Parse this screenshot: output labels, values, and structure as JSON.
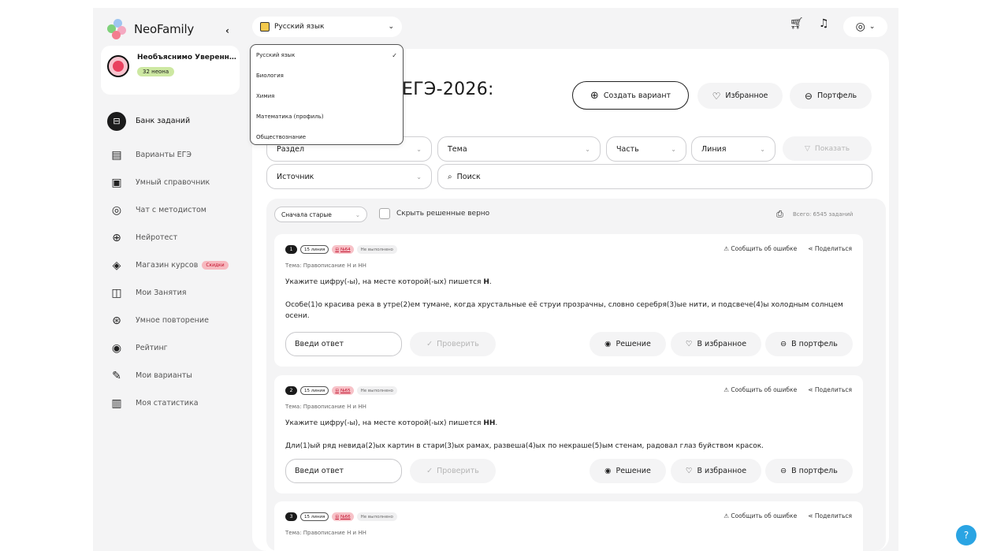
{
  "app": {
    "name": "NeoFamily"
  },
  "user": {
    "name": "Необъяснимо Уверенн…",
    "balance": "32 неона"
  },
  "nav": [
    {
      "label": "Банк заданий",
      "icon": "archive-icon",
      "glyph": "⊟"
    },
    {
      "label": "Варианты ЕГЭ",
      "icon": "document-icon",
      "glyph": "▤"
    },
    {
      "label": "Умный справочник",
      "icon": "book-icon",
      "glyph": "▣"
    },
    {
      "label": "Чат с методистом",
      "icon": "chat-icon",
      "glyph": "◎"
    },
    {
      "label": "Нейротест",
      "icon": "robot-icon",
      "glyph": "⊕"
    },
    {
      "label": "Магазин курсов",
      "icon": "graduation-cap-icon",
      "glyph": "◈",
      "badge": "Скидки"
    },
    {
      "label": "Мои Занятия",
      "icon": "open-book-icon",
      "glyph": "◫"
    },
    {
      "label": "Умное повторение",
      "icon": "brain-icon",
      "glyph": "⊛"
    },
    {
      "label": "Рейтинг",
      "icon": "target-icon",
      "glyph": "◉"
    },
    {
      "label": "Мои варианты",
      "icon": "pencil-icon",
      "glyph": "✎"
    },
    {
      "label": "Моя статистика",
      "icon": "chart-icon",
      "glyph": "▥"
    }
  ],
  "subject_selector": {
    "value": "Русский язык"
  },
  "dropdown": {
    "options": [
      "Русский язык",
      "Биология",
      "Химия",
      "Математика (профиль)",
      "Обществознание"
    ],
    "selected": "Русский язык"
  },
  "header": {
    "title": "ЕГЭ-2026:",
    "create_label": "Создать вариант",
    "favorites_label": "Избранное",
    "portfolio_label": "Портфель"
  },
  "filters": {
    "section": "Раздел",
    "topic": "Тема",
    "part": "Часть",
    "line": "Линия",
    "show": "Показать",
    "source": "Источник",
    "search_placeholder": "Поиск"
  },
  "list": {
    "sort": "Сначала старые",
    "hide_solved": "Скрыть решенные верно",
    "total": "Всего: 6545 заданий"
  },
  "card_labels": {
    "report": "Сообщить об ошибке",
    "share": "Поделиться",
    "answer_placeholder": "Введи ответ",
    "check": "Проверить",
    "solution": "Решение",
    "to_favorites": "В избранное",
    "to_portfolio": "В портфель"
  },
  "tasks": [
    {
      "num": "1",
      "line": "15 линия",
      "bank_no": "№64",
      "status": "Не выполнено",
      "theme": "Тема: Правописание Н и НН",
      "question_prefix": "Укажите цифру(-ы), на месте которой(-ых) пишется ",
      "question_letter": "Н",
      "question_suffix": ".",
      "sentence": "Особе(1)о красива река в утре(2)ем тумане, когда хрустальные её струи прозрачны, словно серебря(3)ые нити, и подсвече(4)ы холодным солнцем осени."
    },
    {
      "num": "2",
      "line": "15 линия",
      "bank_no": "№65",
      "status": "Не выполнено",
      "theme": "Тема: Правописание Н и НН",
      "question_prefix": "Укажите цифру(-ы), на месте которой(-ых) пишется ",
      "question_letter": "НН",
      "question_suffix": ".",
      "sentence": "Дли(1)ый ряд невида(2)ых картин в стари(3)ых рамах, развеша(4)ых по некраше(5)ым стенам, радовал глаз буйством красок."
    },
    {
      "num": "3",
      "line": "15 линия",
      "bank_no": "№66",
      "status": "Не выполнено",
      "theme": "Тема: Правописание Н и НН"
    }
  ],
  "colors": {
    "accent_red": "#e9415f",
    "help_blue": "#2aa4e3",
    "badge_green": "#cde8a2"
  }
}
